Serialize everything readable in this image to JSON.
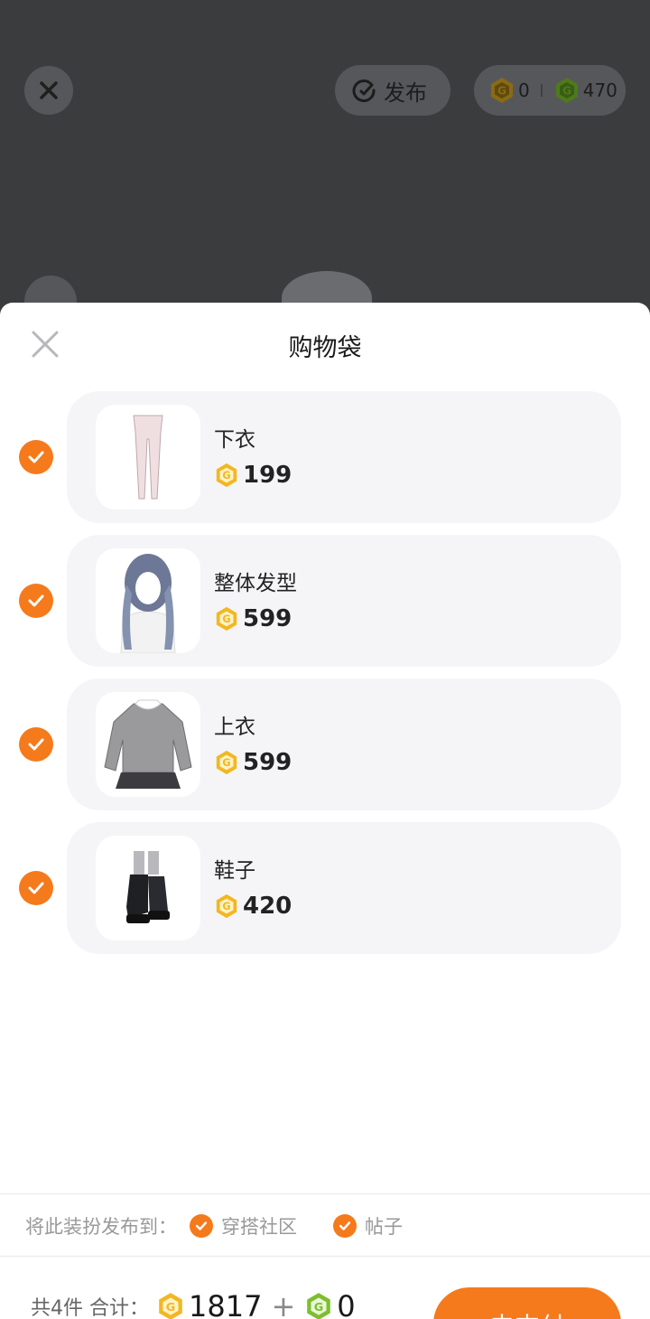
{
  "topbar": {
    "publish_label": "发布",
    "coin_gold": "0",
    "coin_green": "470"
  },
  "sheet": {
    "title": "购物袋",
    "items": [
      {
        "name": "下衣",
        "price": "199",
        "checked": true
      },
      {
        "name": "整体发型",
        "price": "599",
        "checked": true
      },
      {
        "name": "上衣",
        "price": "599",
        "checked": true
      },
      {
        "name": "鞋子",
        "price": "420",
        "checked": true
      }
    ],
    "publish_to_label": "将此装扮发布到：",
    "publish_options": [
      "穿搭社区",
      "帖子"
    ]
  },
  "footer": {
    "count_label": "共4件 合计：",
    "total_gold": "1817",
    "plus": "+",
    "total_green": "0",
    "pay_label": "去支付"
  },
  "colors": {
    "accent": "#f57a1c",
    "gold": "#f2b722",
    "green": "#7cbf2c"
  }
}
